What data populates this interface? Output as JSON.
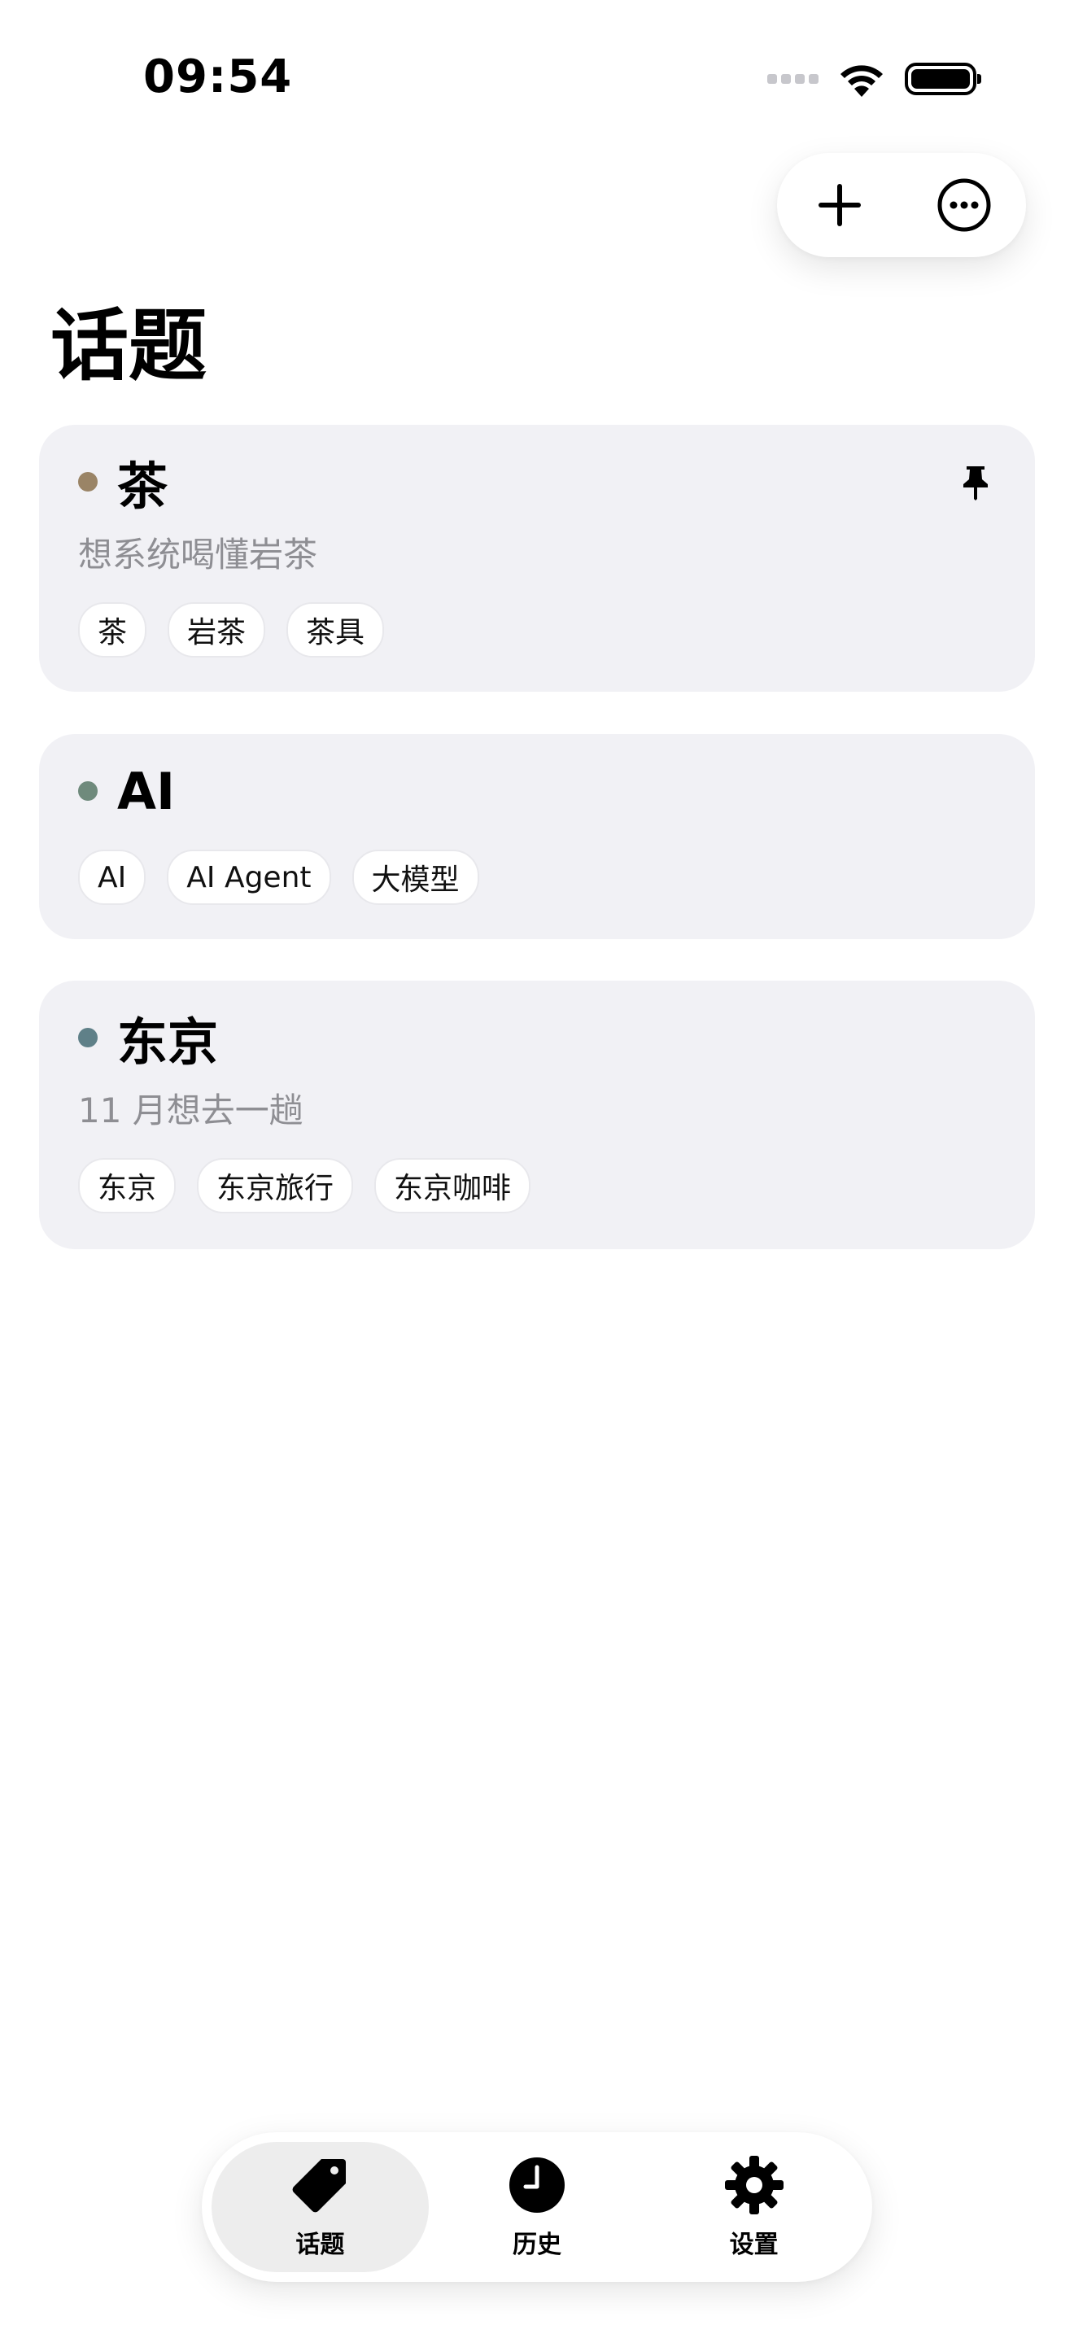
{
  "status_bar": {
    "time": "09:54"
  },
  "page": {
    "title": "话题"
  },
  "topics": [
    {
      "title": "茶",
      "description": "想系统喝懂岩茶",
      "tags": [
        "茶",
        "岩茶",
        "茶具"
      ],
      "dot_color": "#9a8466",
      "pinned": true
    },
    {
      "title": "AI",
      "description": "",
      "tags": [
        "AI",
        "AI Agent",
        "大模型"
      ],
      "dot_color": "#6f8a7c",
      "pinned": false
    },
    {
      "title": "东京",
      "description": "11 月想去一趟",
      "tags": [
        "东京",
        "东京旅行",
        "东京咖啡"
      ],
      "dot_color": "#5f8088",
      "pinned": false
    }
  ],
  "tab_bar": {
    "tabs": [
      {
        "label": "话题",
        "icon": "tag-icon",
        "active": true
      },
      {
        "label": "历史",
        "icon": "clock-icon",
        "active": false
      },
      {
        "label": "设置",
        "icon": "gear-icon",
        "active": false
      }
    ]
  },
  "icons": {
    "add": "plus-icon",
    "more": "ellipsis-circle-icon",
    "pin": "pin-icon"
  }
}
